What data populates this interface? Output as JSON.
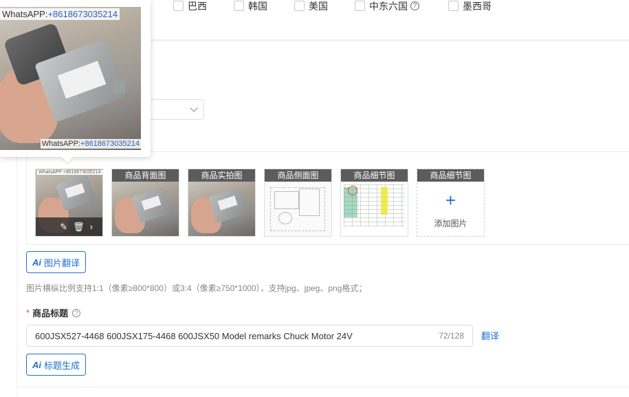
{
  "countries": [
    {
      "label": "巴西",
      "checked": false
    },
    {
      "label": "韩国",
      "checked": false
    },
    {
      "label": "美国",
      "checked": false
    },
    {
      "label": "中东六国",
      "checked": false,
      "help": true
    },
    {
      "label": "墨西哥",
      "checked": false
    }
  ],
  "preview": {
    "watermark_prefix": "WhatsAPP:",
    "watermark_number": "+8618673035214",
    "watermark_bottom_prefix": "WhatsAPP:",
    "watermark_bottom_number": "+8618673035214"
  },
  "images": [
    {
      "caption": "",
      "kind": "main",
      "hovered": true
    },
    {
      "caption": "商品背面图",
      "kind": "photo"
    },
    {
      "caption": "商品实拍图",
      "kind": "photo"
    },
    {
      "caption": "商品侧面图",
      "kind": "drawing"
    },
    {
      "caption": "商品细节图",
      "kind": "table"
    },
    {
      "caption": "商品细节图",
      "kind": "add",
      "add_label": "添加图片"
    }
  ],
  "hover_actions": {
    "edit_icon": "pencil-icon",
    "delete_icon": "trash-icon",
    "next_icon": "chevron-right-icon"
  },
  "image_translate_button": "图片翻译",
  "image_hint": "图片横纵比例支持1:1（像素≥800*800）或3:4（像素≥750*1000），支持jpg、jpeg、png格式；",
  "title_field": {
    "required_mark": "*",
    "label": "商品标题",
    "value": "600JSX527-4468 600JSX175-4468 600JSX50   Model remarks   Chuck Motor 24V",
    "count": "72/128",
    "translate_link": "翻译",
    "generate_button": "标题生成"
  },
  "colors": {
    "accent": "#1f6fd1",
    "required": "#e14b3b"
  }
}
